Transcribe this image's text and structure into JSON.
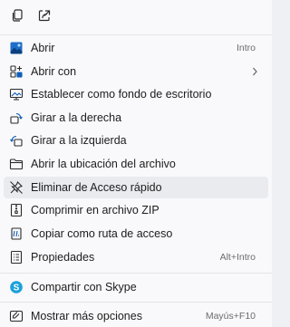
{
  "colors": {
    "accent": "#0f5fb8",
    "skype": "#1aa0dc",
    "text": "#1c1c1c",
    "shortcut": "#6b6b6b"
  },
  "toolbar": {
    "icons": [
      "copy-icon",
      "share-icon"
    ]
  },
  "menu": {
    "items": [
      {
        "label": "Abrir",
        "shortcut": "Intro",
        "icon": "image-file-icon"
      },
      {
        "label": "Abrir con",
        "shortcut": "",
        "icon": "open-with-icon",
        "submenu": true
      },
      {
        "label": "Establecer como fondo de escritorio",
        "shortcut": "",
        "icon": "wallpaper-icon"
      },
      {
        "label": "Girar a la derecha",
        "shortcut": "",
        "icon": "rotate-right-icon"
      },
      {
        "label": "Girar a la izquierda",
        "shortcut": "",
        "icon": "rotate-left-icon"
      },
      {
        "label": "Abrir la ubicación del archivo",
        "shortcut": "",
        "icon": "folder-icon"
      },
      {
        "label": "Eliminar de Acceso rápido",
        "shortcut": "",
        "icon": "unpin-icon"
      },
      {
        "label": "Comprimir en archivo ZIP",
        "shortcut": "",
        "icon": "zip-icon"
      },
      {
        "label": "Copiar como ruta de acceso",
        "shortcut": "",
        "icon": "copy-path-icon"
      },
      {
        "label": "Propiedades",
        "shortcut": "Alt+Intro",
        "icon": "properties-icon"
      },
      {
        "label": "Compartir con Skype",
        "shortcut": "",
        "icon": "skype-icon"
      },
      {
        "label": "Mostrar más opciones",
        "shortcut": "Mayús+F10",
        "icon": "more-options-icon"
      }
    ]
  }
}
